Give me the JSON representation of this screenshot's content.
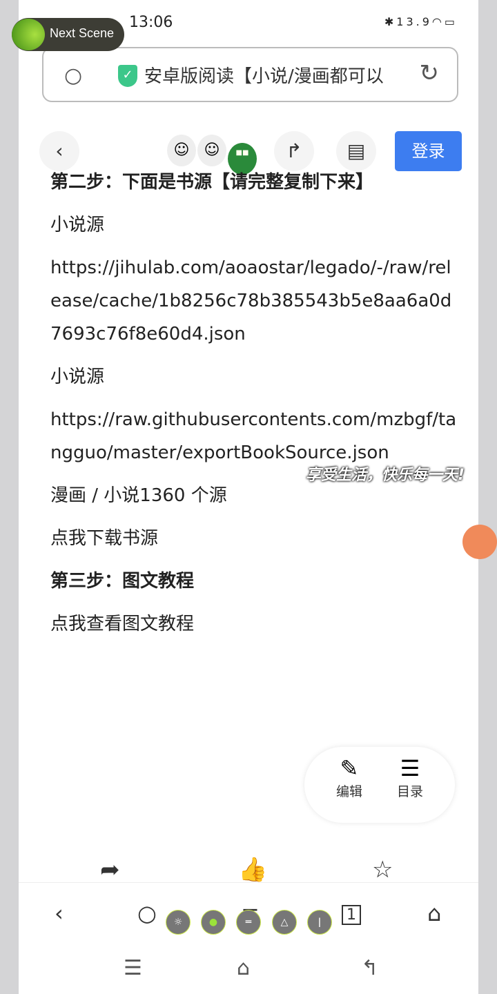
{
  "overlay": {
    "next_scene": "Next Scene",
    "caption": "享受生活，快乐每一天!"
  },
  "status": {
    "time": "13:06",
    "net_speed": "13.9",
    "icons": [
      "hd-icon",
      "bluetooth-icon",
      "wifi-icon",
      "battery-icon"
    ]
  },
  "urlbar": {
    "title": "安卓版阅读【小说/漫画都可以"
  },
  "toolbar": {
    "login": "登录"
  },
  "content": {
    "step2": "第二步：下面是书源【请完整复制下来】",
    "label1": "小说源",
    "url1": "https://jihulab.com/aoaostar/legado/-/raw/release/cache/1b8256c78b385543b5e8aa6a0d7693c76f8e60d4.json",
    "label2": "小说源",
    "url2": "https://raw.githubusercontents.com/mzbgf/tangguo/master/exportBookSource.json",
    "label3": "漫画 / 小说1360 个源",
    "download": "点我下载书源",
    "step3": "第三步：图文教程",
    "tutorial": "点我查看图文教程"
  },
  "float": {
    "edit": "编辑",
    "toc": "目录"
  },
  "bottomnav": {
    "tabs_count": "1"
  }
}
